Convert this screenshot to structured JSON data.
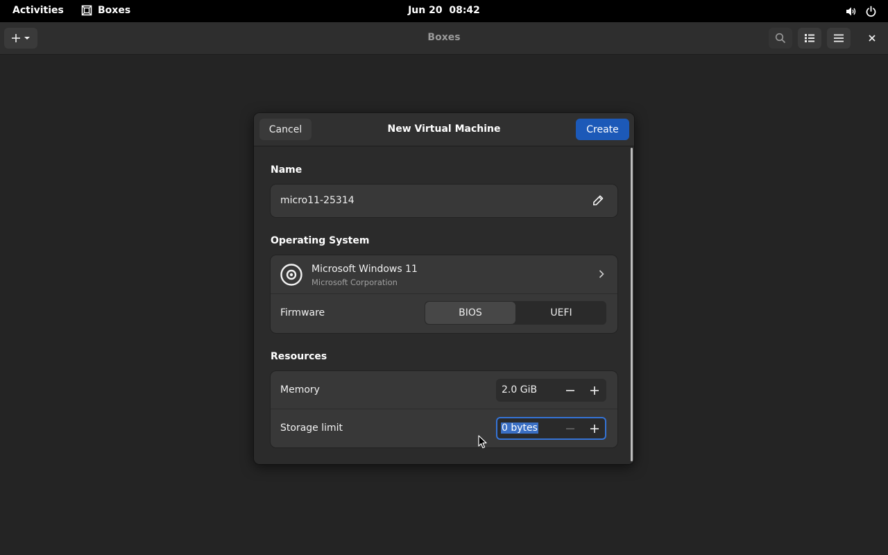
{
  "topbar": {
    "activities": "Activities",
    "app_name": "Boxes",
    "clock": "Jun 20  08:42"
  },
  "headerbar": {
    "title": "Boxes"
  },
  "dialog": {
    "title": "New Virtual Machine",
    "cancel_label": "Cancel",
    "create_label": "Create",
    "name_section": {
      "label": "Name",
      "value": "micro11-25314"
    },
    "os_section": {
      "label": "Operating System",
      "os_name": "Microsoft Windows 11",
      "os_vendor": "Microsoft Corporation",
      "firmware_label": "Firmware",
      "firmware_options": [
        "BIOS",
        "UEFI"
      ],
      "firmware_selected": "BIOS"
    },
    "resources_section": {
      "label": "Resources",
      "memory_label": "Memory",
      "memory_value": "2.0 GiB",
      "storage_label": "Storage limit",
      "storage_value": "0 bytes"
    }
  },
  "colors": {
    "accent": "#1c59b8",
    "focus": "#3574d8",
    "background": "#242424",
    "card": "#383838"
  }
}
